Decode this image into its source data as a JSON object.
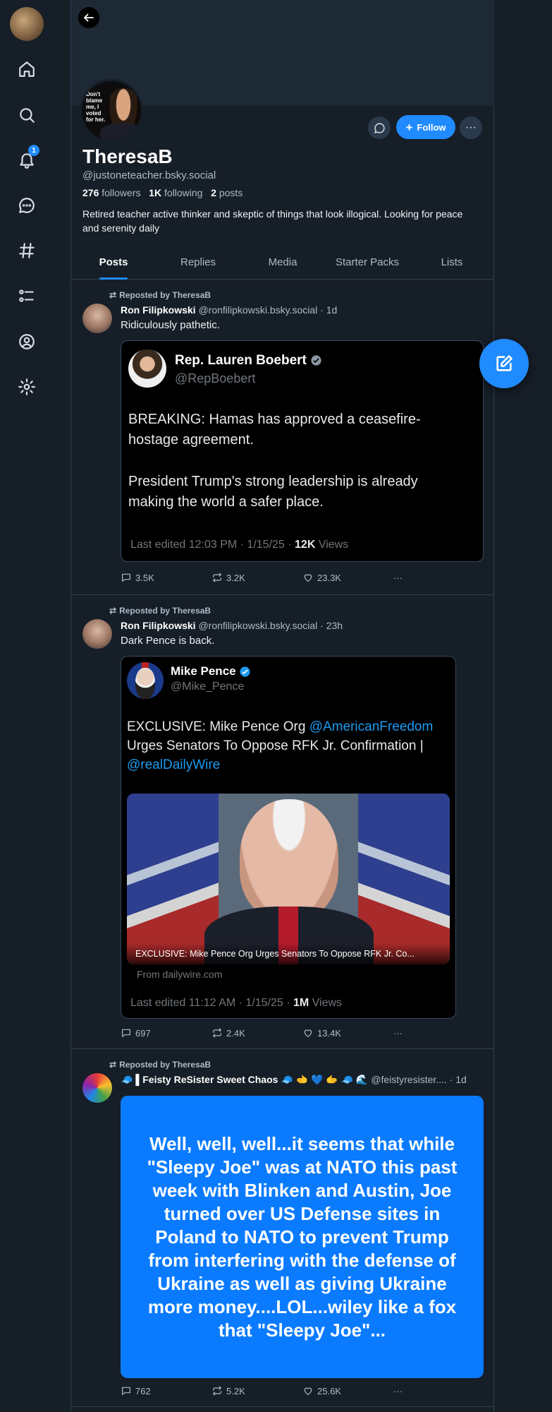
{
  "nav": {
    "notifications_badge": "1"
  },
  "profile": {
    "avatar_text": "Don't blame me, I voted for her.",
    "follow_label": "Follow",
    "display_name": "TheresaB",
    "handle": "@justoneteacher.bsky.social",
    "followers_count": "276",
    "followers_label": "followers",
    "following_count": "1K",
    "following_label": "following",
    "posts_count": "2",
    "posts_label": "posts",
    "bio": "Retired teacher active thinker and skeptic of things that look illogical. Looking for peace and serenity daily"
  },
  "tabs": [
    "Posts",
    "Replies",
    "Media",
    "Starter Packs",
    "Lists"
  ],
  "posts": [
    {
      "repost_label": "Reposted by TheresaB",
      "author": "Ron Filipkowski",
      "handle_time": "@ronfilipkowski.bsky.social · 1d",
      "text": "Ridiculously pathetic.",
      "embed": {
        "name": "Rep. Lauren Boebert",
        "handle": "@RepBoebert",
        "body1": "BREAKING: Hamas has approved a ceasefire-hostage agreement.",
        "body2": "President Trump's strong leadership is already making the world a safer place.",
        "meta": "Last edited 12:03 PM · 1/15/25 · ",
        "views_count": "12K",
        "views_label": " Views"
      },
      "replies": "3.5K",
      "reposts": "3.2K",
      "likes": "23.3K"
    },
    {
      "repost_label": "Reposted by TheresaB",
      "author": "Ron Filipkowski",
      "handle_time": "@ronfilipkowski.bsky.social · 23h",
      "text": "Dark Pence is back.",
      "embed": {
        "name": "Mike Pence",
        "handle": "@Mike_Pence",
        "body_pre": "EXCLUSIVE: Mike Pence Org ",
        "link1": "@AmericanFreedom",
        "body_mid": " Urges Senators To Oppose RFK Jr. Confirmation | ",
        "link2": "@realDailyWire",
        "image_caption": "EXCLUSIVE: Mike Pence Org Urges Senators To Oppose RFK Jr. Co...",
        "source": "From dailywire.com",
        "meta": "Last edited 11:12 AM · 1/15/25 · ",
        "views_count": "1M",
        "views_label": " Views"
      },
      "replies": "697",
      "reposts": "2.4K",
      "likes": "13.4K"
    },
    {
      "repost_label": "Reposted by TheresaB",
      "author": "🧢 ▌Feisty ReSister Sweet Chaos 🧢 🫲 💙 🫱 🧢 🌊",
      "handle_time": "@feistyresister.... · 1d",
      "card_text": "Well, well, well...it seems that while \"Sleepy Joe\" was at NATO this past week with Blinken and Austin, Joe turned over US Defense sites in Poland to NATO to prevent Trump from interfering with the defense of Ukraine as well as giving Ukraine more money....LOL...wiley like a fox that \"Sleepy Joe\"...",
      "replies": "762",
      "reposts": "5.2K",
      "likes": "25.6K"
    }
  ]
}
